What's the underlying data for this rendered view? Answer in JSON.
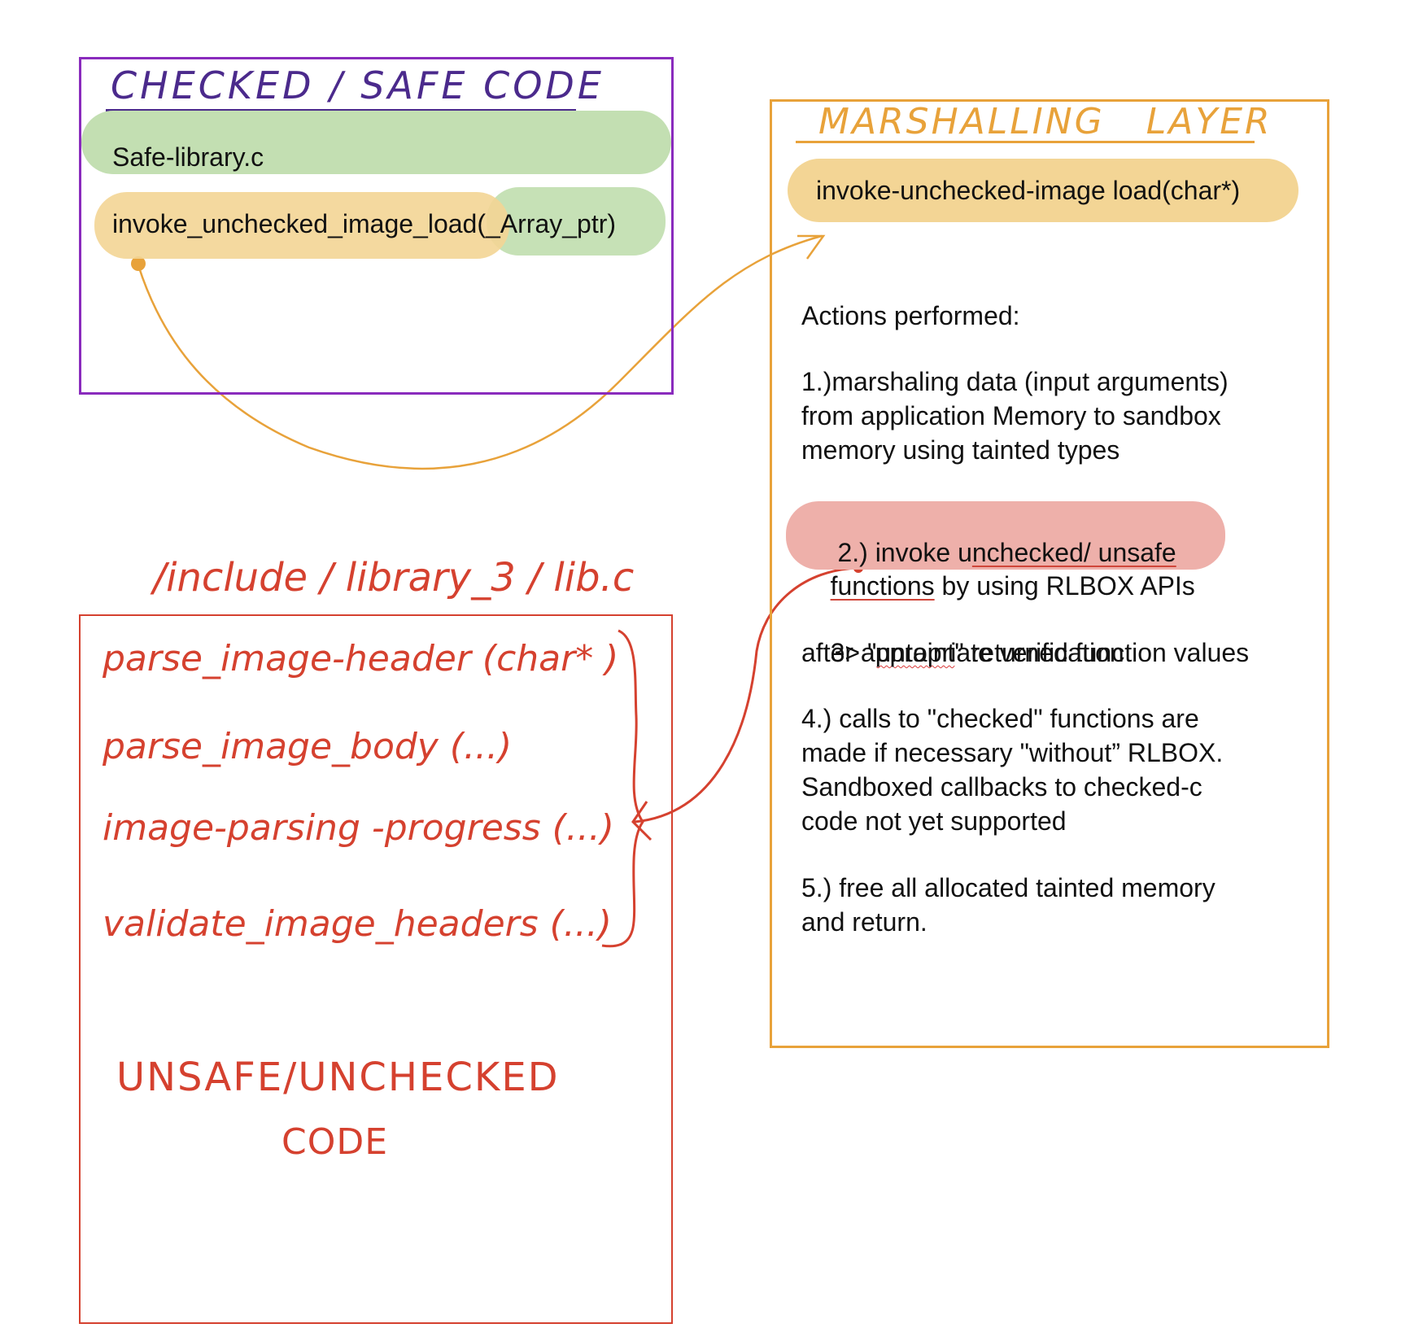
{
  "colors": {
    "checked_border": "#8a2bbd",
    "checked_heading": "#4b2a8c",
    "marshal_border": "#e8a23a",
    "unsafe_red": "#d5412f",
    "green_highlight": "#c3dfb2",
    "orange_highlight": "#f3d595",
    "red_highlight": "#eeb0aa"
  },
  "checked_box": {
    "heading": "CHECKED / SAFE CODE",
    "file_label": "Safe-library.c",
    "call_name": "invoke_unchecked_image_load",
    "call_args": "(_Array_ptr)"
  },
  "marshalling_box": {
    "heading": "MARSHALLING   LAYER",
    "function_label": "invoke-unchecked-image load(char*)",
    "actions_title": "Actions performed:",
    "step1": [
      "1.)marshaling data (input arguments)",
      "from application Memory to sandbox",
      "memory using tainted types"
    ],
    "step2_prefix": " 2.) invoke u",
    "step2_underlined": "nchecked/ unsafe",
    "step2_line2_underlined": "functions",
    "step2_line2_rest": " by using RLBOX APIs",
    "step3_prefix": "3> \"",
    "step3_squiggle": "untaint",
    "step3_rest": "\" returned function values",
    "step3_line2": "after appropriate verification",
    "step4": [
      "4.) calls to \"checked\" functions are",
      "made if necessary \"without” RLBOX.",
      "Sandboxed callbacks to checked-c",
      "code not yet supported"
    ],
    "step5": [
      "5.) free all allocated tainted memory",
      "and return."
    ]
  },
  "unsafe_box": {
    "path_label": "/include / library_3 / lib.c",
    "functions": [
      "parse_image-header (char* )",
      "parse_image_body (...)",
      "image-parsing -progress (...)",
      "validate_image_headers (...)"
    ],
    "caption_line1": "UNSAFE/UNCHECKED",
    "caption_line2": "CODE"
  }
}
